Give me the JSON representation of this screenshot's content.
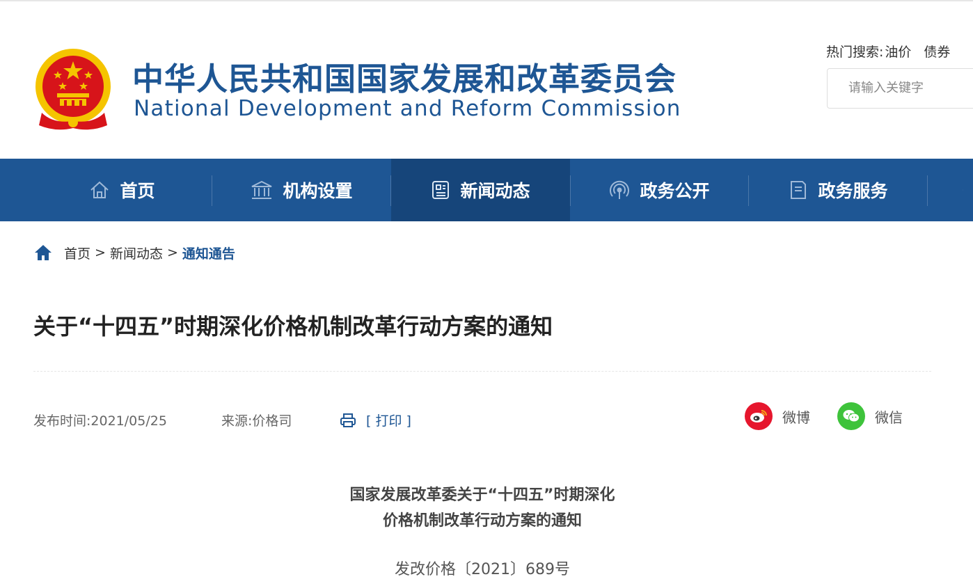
{
  "header": {
    "title_cn": "中华人民共和国国家发展和改革委员会",
    "title_en": "National Development and Reform Commission",
    "hot_search_label": "热门搜索:",
    "hot_search_keywords": [
      "油价",
      "债券"
    ],
    "search_placeholder": "请输入关键字"
  },
  "nav": {
    "items": [
      {
        "label": "首页",
        "icon": "home-icon"
      },
      {
        "label": "机构设置",
        "icon": "institution-icon"
      },
      {
        "label": "新闻动态",
        "icon": "news-icon"
      },
      {
        "label": "政务公开",
        "icon": "broadcast-icon"
      },
      {
        "label": "政务服务",
        "icon": "document-icon"
      }
    ],
    "active_index": 2
  },
  "breadcrumb": {
    "items": [
      "首页",
      "新闻动态",
      "通知通告"
    ],
    "separator": ">"
  },
  "article": {
    "title": "关于“十四五”时期深化价格机制改革行动方案的通知",
    "publish_label": "发布时间:",
    "publish_date": "2021/05/25",
    "source_label": "来源:",
    "source": "价格司",
    "print_label": "[ 打印 ]",
    "share": [
      {
        "label": "微博",
        "icon": "weibo-icon",
        "color": "#e6162d"
      },
      {
        "label": "微信",
        "icon": "wechat-icon",
        "color": "#3ec33b"
      }
    ],
    "doc_heading_line1": "国家发展改革委关于“十四五”时期深化",
    "doc_heading_line2": "价格机制改革行动方案的通知",
    "doc_number": "发改价格〔2021〕689号"
  },
  "colors": {
    "brand_blue": "#1e5694",
    "nav_active": "#16457a",
    "emblem_red": "#d7141a",
    "emblem_gold": "#f5c400"
  }
}
